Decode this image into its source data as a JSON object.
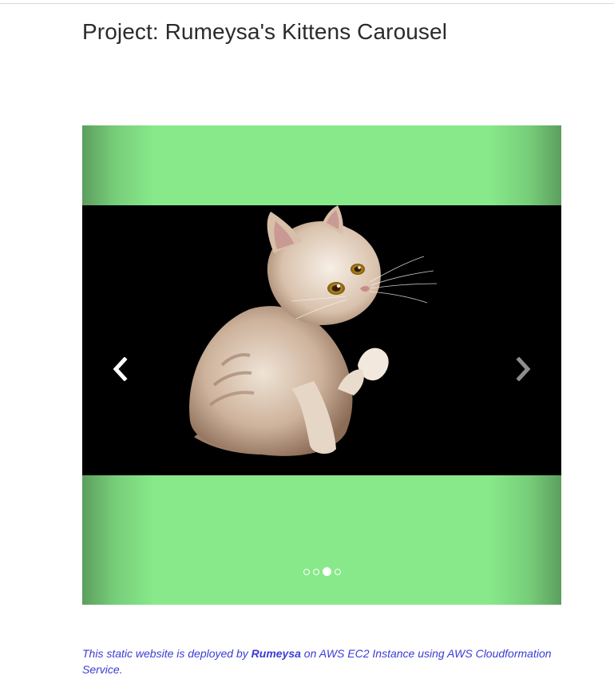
{
  "page": {
    "title": "Project: Rumeysa's Kittens Carousel"
  },
  "carousel": {
    "slide_alt": "Kitten",
    "indicator_count": 4,
    "active_index": 2,
    "background_color": "#87e98a",
    "prev_icon": "chevron-left-icon",
    "next_icon": "chevron-right-icon"
  },
  "footer": {
    "prefix": "This static website is deployed by ",
    "author": "Rumeysa",
    "suffix": " on AWS EC2 Instance using AWS Cloudformation Service."
  }
}
